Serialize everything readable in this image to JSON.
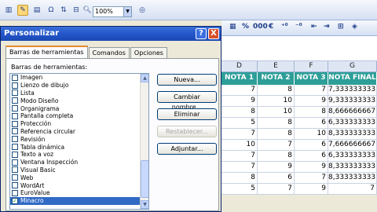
{
  "excel": {
    "zoom": "100%",
    "format_bar": {
      "percent": "%",
      "thousands": "000",
      "euro": "€",
      "dec_inc": "⁺⁰",
      "dec_dec": "⁻⁰"
    },
    "columns": [
      "D",
      "E",
      "F",
      "G"
    ],
    "headers": [
      "NOTA 1",
      "NOTA 2",
      "NOTA 3",
      "NOTA FINAL"
    ],
    "rows": [
      [
        "7",
        "8",
        "7",
        "7,333333333"
      ],
      [
        "9",
        "10",
        "9",
        "9,333333333"
      ],
      [
        "8",
        "10",
        "8",
        "8,666666667"
      ],
      [
        "5",
        "8",
        "6",
        "6,333333333"
      ],
      [
        "7",
        "8",
        "10",
        "8,333333333"
      ],
      [
        "10",
        "7",
        "6",
        "7,666666667"
      ],
      [
        "7",
        "8",
        "6",
        "6,333333333"
      ],
      [
        "7",
        "9",
        "9",
        "8,333333333"
      ],
      [
        "8",
        "6",
        "7",
        "8,333333333"
      ],
      [
        "5",
        "7",
        "9",
        "7"
      ]
    ]
  },
  "dialog": {
    "title": "Personalizar",
    "tabs": [
      "Barras de herramientas",
      "Comandos",
      "Opciones"
    ],
    "list_label": "Barras de herramientas:",
    "items": [
      {
        "label": "Imagen",
        "checked": false
      },
      {
        "label": "Lienzo de dibujo",
        "checked": false
      },
      {
        "label": "Lista",
        "checked": false
      },
      {
        "label": "Modo Diseño",
        "checked": false
      },
      {
        "label": "Organigrama",
        "checked": false
      },
      {
        "label": "Pantalla completa",
        "checked": false
      },
      {
        "label": "Protección",
        "checked": false
      },
      {
        "label": "Referencia circular",
        "checked": false
      },
      {
        "label": "Revisión",
        "checked": false
      },
      {
        "label": "Tabla dinámica",
        "checked": false
      },
      {
        "label": "Texto a voz",
        "checked": false
      },
      {
        "label": "Ventana Inspección",
        "checked": false
      },
      {
        "label": "Visual Basic",
        "checked": false
      },
      {
        "label": "Web",
        "checked": false
      },
      {
        "label": "WordArt",
        "checked": false
      },
      {
        "label": "EuroValue",
        "checked": false
      },
      {
        "label": "Minacro",
        "checked": true,
        "selected": true
      }
    ],
    "buttons": {
      "new": "Nueva...",
      "rename": "Cambiar nombre...",
      "delete": "Eliminar",
      "reset": "Restablecer...",
      "attach": "Adjuntar..."
    },
    "controls": {
      "help": "?",
      "close": "X"
    }
  },
  "colors": {
    "nota_header": "#2d9e98",
    "selection": "#316ac5",
    "titlebar": "#2456c9"
  }
}
